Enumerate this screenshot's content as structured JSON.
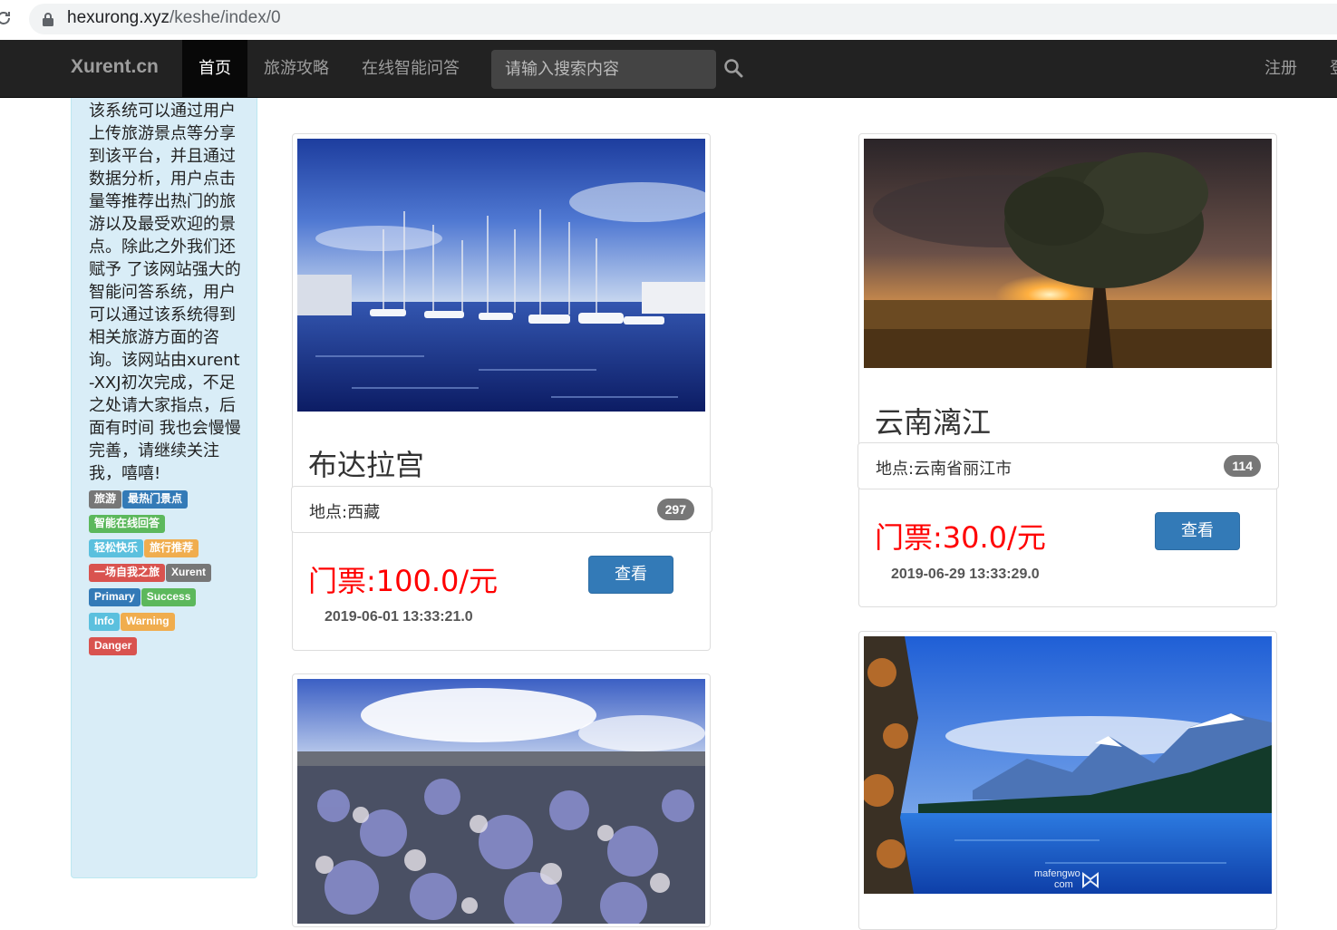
{
  "browser": {
    "url_host": "hexurong.xyz",
    "url_path": "/keshe/index/0"
  },
  "navbar": {
    "brand": "Xurent.cn",
    "items": [
      {
        "label": "首页",
        "active": true
      },
      {
        "label": "旅游攻略"
      },
      {
        "label": "在线智能问答"
      }
    ],
    "search_placeholder": "请输入搜索内容",
    "register": "注册",
    "login_partial": "登"
  },
  "sidebar": {
    "intro": "该系统可以通过用户上传旅游景点等分享到该平台，并且通过数据分析，用户点击量等推荐出热门的旅游以及最受欢迎的景点。除此之外我们还赋予 了该网站强大的智能问答系统，用户可以通过该系统得到相关旅游方面的咨询。该网站由xurent-XXJ初次完成，不足之处请大家指点，后面有时间 我也会慢慢完善，请继续关注我，嘻嘻!",
    "tags": [
      {
        "text": "旅游",
        "style": "default"
      },
      {
        "text": "最热门景点",
        "style": "primary"
      },
      {
        "text": "智能在线回答",
        "style": "success"
      },
      {
        "text": "轻松快乐",
        "style": "info"
      },
      {
        "text": "旅行推荐",
        "style": "warning"
      },
      {
        "text": "一场自我之旅",
        "style": "danger"
      },
      {
        "text": "Xurent",
        "style": "default"
      },
      {
        "text": "Primary",
        "style": "primary"
      },
      {
        "text": "Success",
        "style": "success"
      },
      {
        "text": "Info",
        "style": "info"
      },
      {
        "text": "Warning",
        "style": "warning"
      },
      {
        "text": "Danger",
        "style": "danger"
      }
    ]
  },
  "cards": [
    {
      "title": "布达拉宫",
      "location": "地点:西藏",
      "views": "297",
      "price": "门票:100.0/元",
      "button": "查看",
      "date": "2019-06-01 13:33:21.0"
    },
    {
      "title": "云南漓江",
      "location": "地点:云南省丽江市",
      "views": "114",
      "price": "门票:30.0/元",
      "button": "查看",
      "date": "2019-06-29 13:33:29.0"
    }
  ],
  "watermark": {
    "line1": "mafengwo",
    "line2": "com"
  },
  "colors": {
    "navbar_bg": "#222222",
    "sidebar_bg": "#d9edf7",
    "price": "#ff0000",
    "button": "#337ab7"
  }
}
